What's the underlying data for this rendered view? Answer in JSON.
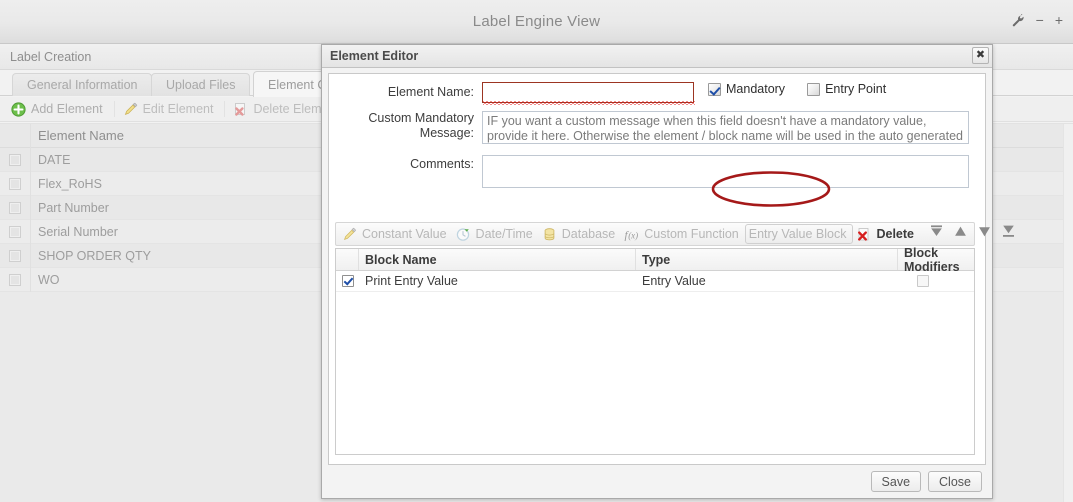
{
  "window": {
    "title": "Label Engine View",
    "controls": [
      {
        "name": "wrench-icon",
        "glyph": "\u0000"
      },
      {
        "name": "minimize-icon",
        "glyph": "−"
      },
      {
        "name": "maximize-icon",
        "glyph": "+"
      }
    ],
    "minimize_glyph": "−",
    "maximize_glyph": "+"
  },
  "background_panel": {
    "title": "Label Creation",
    "tabs": [
      {
        "label": "General Information",
        "active": false
      },
      {
        "label": "Upload Files",
        "active": false
      },
      {
        "label": "Element Cr",
        "active": true
      }
    ],
    "toolbar": [
      {
        "label": "Add Element",
        "icon": "add-green-plus-icon",
        "enabled": true
      },
      {
        "label": "Edit Element",
        "icon": "pencil-icon",
        "enabled": false
      },
      {
        "label": "Delete Element",
        "icon": "red-x-icon",
        "enabled": false
      }
    ],
    "table": {
      "columns": [
        "",
        "Element Name"
      ],
      "rows": [
        {
          "checked": false,
          "name": "DATE"
        },
        {
          "checked": false,
          "name": "Flex_RoHS"
        },
        {
          "checked": false,
          "name": "Part Number"
        },
        {
          "checked": false,
          "name": "Serial Number"
        },
        {
          "checked": false,
          "name": "SHOP ORDER QTY"
        },
        {
          "checked": false,
          "name": "WO"
        }
      ]
    }
  },
  "dialog": {
    "title": "Element Editor",
    "close_glyph": "✖",
    "fields": {
      "element_name_label": "Element Name:",
      "element_name_value": "",
      "custom_mandatory_label_line1": "Custom Mandatory",
      "custom_mandatory_label_line2": "Message:",
      "custom_mandatory_placeholder": "IF you want a custom message when this field doesn't have a mandatory value, provide it here.  Otherwise the element / block name will be used in the auto generated message.",
      "comments_label": "Comments:",
      "comments_value": ""
    },
    "checkboxes": [
      {
        "label": "Mandatory",
        "checked": true
      },
      {
        "label": "Entry Point",
        "checked": false
      }
    ],
    "block_toolbar": [
      {
        "label": "Constant Value",
        "icon": "pencil-icon",
        "enabled": false,
        "highlighted": false
      },
      {
        "label": "Date/Time",
        "icon": "clock-icon",
        "enabled": false,
        "highlighted": false
      },
      {
        "label": "Database",
        "icon": "database-icon",
        "enabled": false,
        "highlighted": false
      },
      {
        "label": "Custom Function",
        "icon": "function-fx-icon",
        "enabled": false,
        "highlighted": false
      },
      {
        "label": "Entry Value Block",
        "icon": "entry-value-icon",
        "enabled": false,
        "highlighted": true
      },
      {
        "label": "Delete",
        "icon": "red-x-icon",
        "enabled": true,
        "highlighted": false
      }
    ],
    "arrow_buttons": [
      {
        "name": "move-to-top-button"
      },
      {
        "name": "move-up-button"
      },
      {
        "name": "move-down-button"
      },
      {
        "name": "move-to-bottom-button"
      }
    ],
    "blocks_grid": {
      "columns": [
        "",
        "Block Name",
        "Type",
        "Block Modifiers"
      ],
      "rows": [
        {
          "checked": true,
          "block_name": "Print Entry Value",
          "type": "Entry Value",
          "modifier_checked": false
        }
      ]
    },
    "footer_buttons": [
      {
        "label": "Save"
      },
      {
        "label": "Close"
      }
    ]
  },
  "annotation": {
    "shape": "ellipse",
    "target": "Entry Value Block",
    "color": "#a51919"
  },
  "colors": {
    "error_border": "#9c3522",
    "squiggle": "#e01b1b",
    "annotation": "#a51919",
    "checkbox_check": "#1f4fa8",
    "window_bg": "#f2f2f2"
  }
}
